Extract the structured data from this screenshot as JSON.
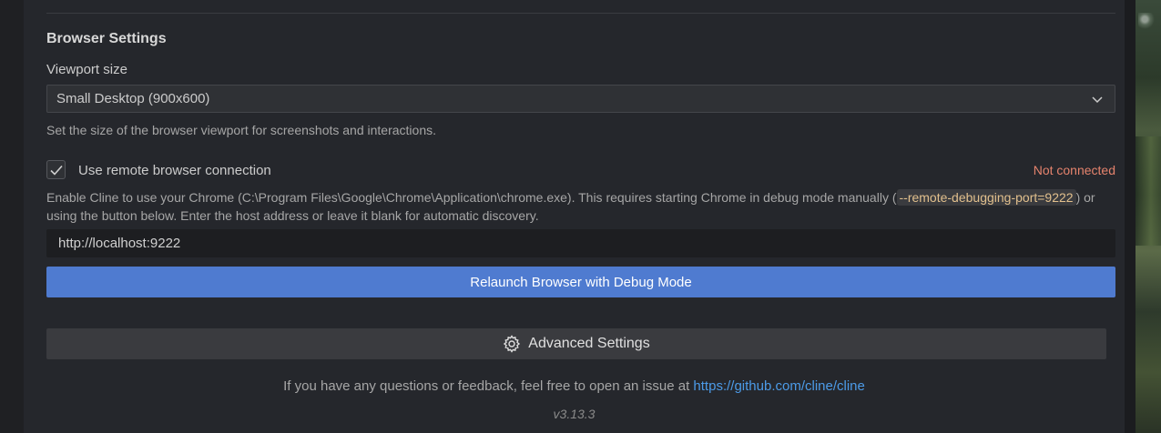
{
  "browser_settings": {
    "title": "Browser Settings",
    "viewport": {
      "label": "Viewport size",
      "selected": "Small Desktop (900x600)",
      "help": "Set the size of the browser viewport for screenshots and interactions."
    },
    "remote": {
      "checkbox_label": "Use remote browser connection",
      "checked": true,
      "status": "Not connected",
      "desc_before": "Enable Cline to use your Chrome (C:\\Program Files\\Google\\Chrome\\Application\\chrome.exe). This requires starting Chrome in debug mode manually (",
      "desc_code": "--remote-debugging-port=9222",
      "desc_after": ") or using the button below. Enter the host address or leave it blank for automatic discovery.",
      "host_value": "http://localhost:9222"
    },
    "relaunch_label": "Relaunch Browser with Debug Mode"
  },
  "advanced_label": "Advanced Settings",
  "footer": {
    "text": "If you have any questions or feedback, feel free to open an issue at ",
    "link": "https://github.com/cline/cline",
    "version": "v3.13.3"
  },
  "colors": {
    "accent_button": "#4f7bd0",
    "status_error": "#e5836d",
    "link": "#4c9be8",
    "code_text": "#e2c08d"
  },
  "icons": {
    "select": "chevron-down-icon",
    "checkbox": "checkmark-icon",
    "advanced": "gear-icon"
  }
}
